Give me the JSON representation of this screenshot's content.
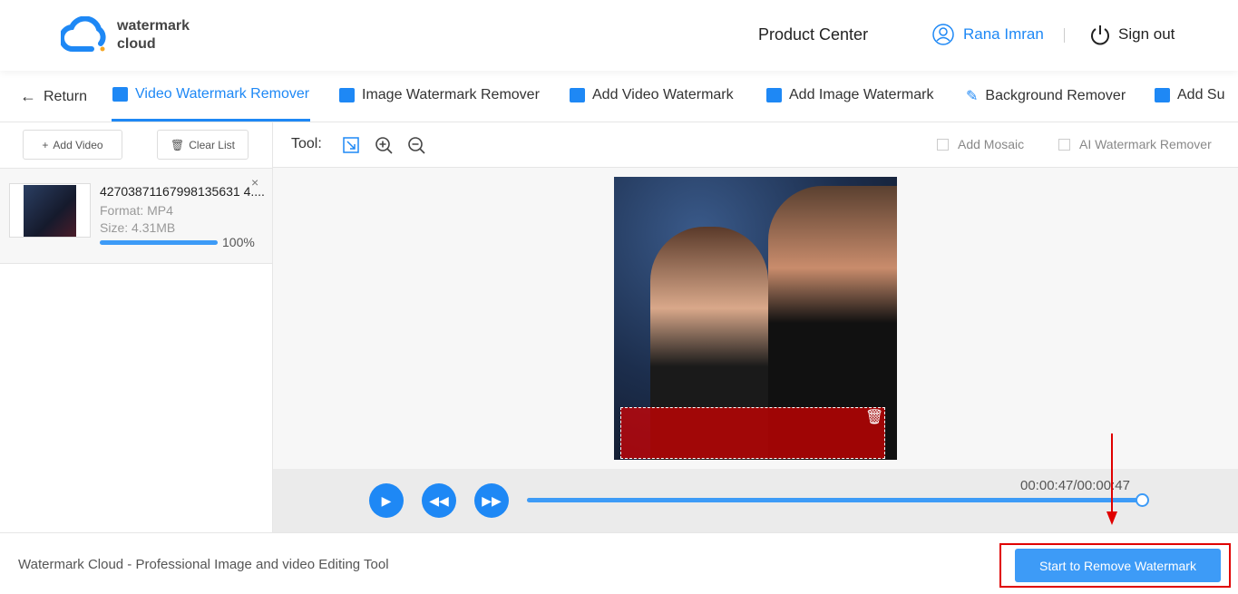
{
  "header": {
    "logo_line1": "watermark",
    "logo_line2": "cloud",
    "product_center": "Product Center",
    "user": "Rana Imran",
    "sign_out": "Sign out"
  },
  "nav": {
    "return": "Return",
    "items": [
      "Video Watermark Remover",
      "Image Watermark Remover",
      "Add Video Watermark",
      "Add Image Watermark",
      "Background Remover",
      "Add Su"
    ]
  },
  "left": {
    "add_video": "Add Video",
    "clear_list": "Clear List",
    "file": {
      "name": "42703871167998135631 4....",
      "format_label": "Format:",
      "format": "MP4",
      "size_label": "Size:",
      "size": "4.31MB",
      "progress_text": "100%",
      "progress": 1.0
    }
  },
  "toolbar": {
    "tool_label": "Tool:",
    "add_mosaic": "Add Mosaic",
    "ai_remover": "AI Watermark Remover"
  },
  "player": {
    "time": "00:00:47/00:00:47",
    "position": 1.0
  },
  "footer": {
    "tagline": "Watermark Cloud - Professional Image and video Editing Tool",
    "start_button": "Start to Remove Watermark"
  },
  "colors": {
    "accent": "#1e88f5",
    "highlight": "#e00000"
  }
}
